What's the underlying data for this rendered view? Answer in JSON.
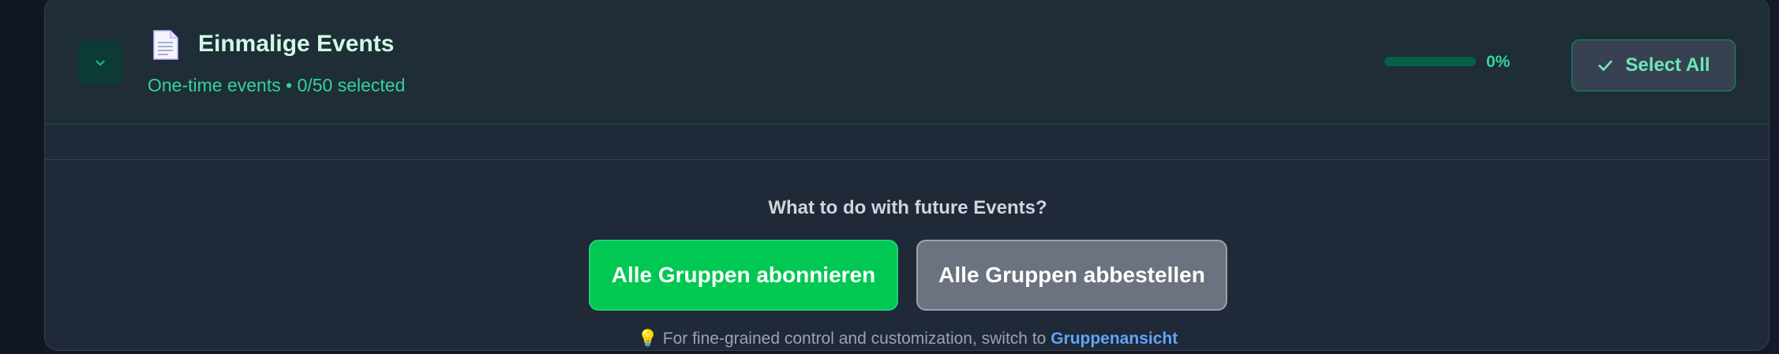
{
  "group": {
    "icon": "document-icon",
    "title": "Einmalige Events",
    "subtitle": "One-time events • 0/50 selected",
    "progress_text": "0%",
    "progress_fraction": 0,
    "select_all_label": "Select All"
  },
  "future_events": {
    "question": "What to do with future Events?",
    "subscribe_label": "Alle Gruppen abonnieren",
    "unsubscribe_label": "Alle Gruppen abbestellen"
  },
  "hint": {
    "icon": "lightbulb-icon",
    "text": "For fine-grained control and customization, switch to",
    "link_text": "Gruppenansicht"
  },
  "colors": {
    "accent": "#10b981",
    "subscribe": "#00c853",
    "unsubscribe": "#6b7280",
    "link": "#60a5fa"
  }
}
